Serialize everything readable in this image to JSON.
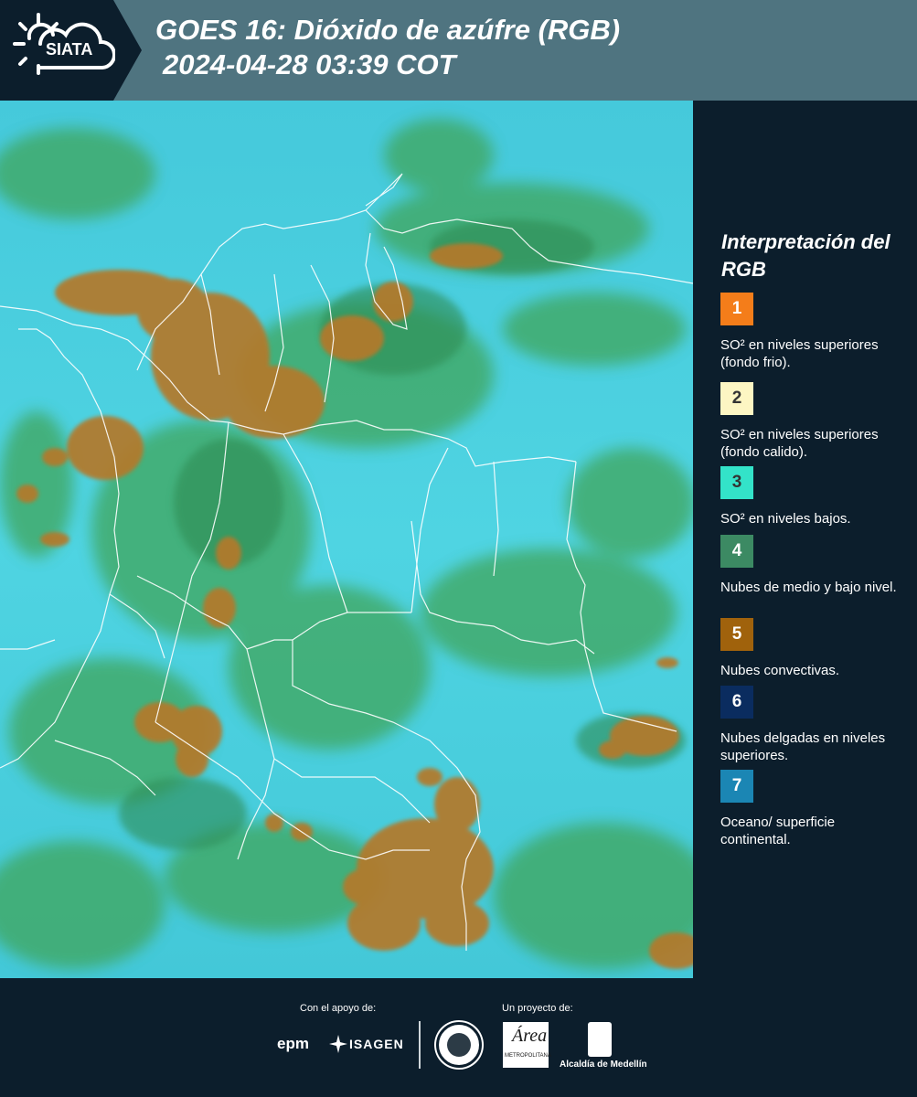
{
  "header": {
    "logo": "SIATA",
    "title_line1": "GOES 16: Dióxido de azúfre (RGB)",
    "title_line2": "2024-04-28 03:39 COT"
  },
  "legend": {
    "title": "Interpretación del RGB",
    "items": [
      {
        "number": "1",
        "label": "SO² en niveles superiores (fondo frio).",
        "color": "#f47d1a",
        "text_color": "#ffffff"
      },
      {
        "number": "2",
        "label": "SO² en niveles superiores (fondo calido).",
        "color": "#fdf6c3",
        "text_color": "#333333"
      },
      {
        "number": "3",
        "label": "SO² en niveles bajos.",
        "color": "#33e3c9",
        "text_color": "#333333"
      },
      {
        "number": "4",
        "label": "Nubes de medio y bajo nivel.",
        "color": "#3c8a63",
        "text_color": "#ffffff"
      },
      {
        "number": "5",
        "label": "Nubes convectivas.",
        "color": "#a0620c",
        "text_color": "#ffffff"
      },
      {
        "number": "6",
        "label": "Nubes delgadas en niveles superiores.",
        "color": "#0a2c5f",
        "text_color": "#ffffff"
      },
      {
        "number": "7",
        "label": "Oceano/ superficie continental.",
        "color": "#1b86b4",
        "text_color": "#ffffff"
      }
    ]
  },
  "footer": {
    "support_label": "Con el apoyo de:",
    "project_label": "Un proyecto de:",
    "epm": "epm",
    "isagen": "ISAGEN",
    "alcaldia": "Alcaldía de Medellín"
  },
  "colors": {
    "background": "#0c1e2c",
    "header_band": "#4f7480",
    "map_cyan": "#49cfe0",
    "map_green": "#3aa157",
    "map_convective": "#b07a2a"
  }
}
